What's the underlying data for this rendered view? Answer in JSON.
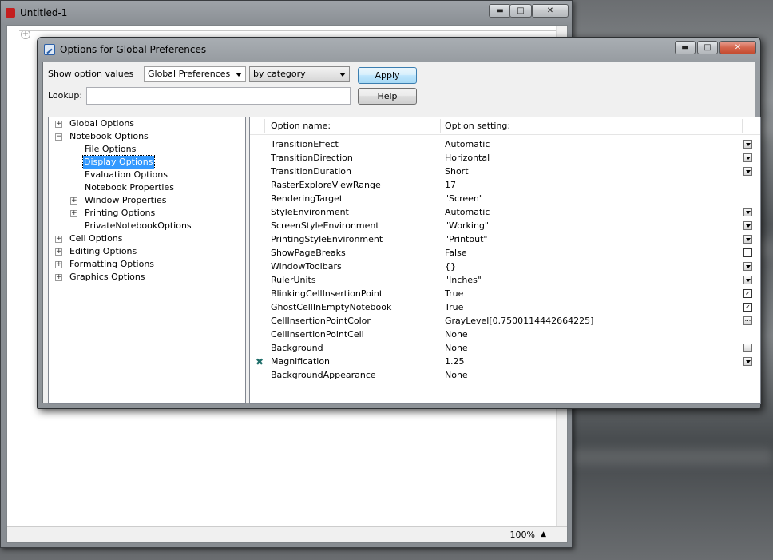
{
  "notebook": {
    "title": "Untitled-1",
    "zoom": "100%",
    "controls": [
      "▬",
      "□",
      "✕"
    ]
  },
  "dialog": {
    "title": "Options for Global Preferences",
    "controls": [
      "▬",
      "□",
      "✕"
    ],
    "show_label": "Show option values",
    "scope_value": "Global Preferences",
    "view_value": "by category",
    "apply_label": "Apply",
    "lookup_label": "Lookup:",
    "lookup_value": "",
    "help_label": "Help",
    "tree": [
      {
        "label": "Global Options",
        "expander": "+"
      },
      {
        "label": "Notebook Options",
        "expander": "−"
      },
      {
        "label": "File Options",
        "expander": ""
      },
      {
        "label": "Display Options",
        "expander": "",
        "selected": true
      },
      {
        "label": "Evaluation Options",
        "expander": ""
      },
      {
        "label": "Notebook Properties",
        "expander": ""
      },
      {
        "label": "Window Properties",
        "expander": "+"
      },
      {
        "label": "Printing Options",
        "expander": "+"
      },
      {
        "label": "PrivateNotebookOptions",
        "expander": ""
      },
      {
        "label": "Cell Options",
        "expander": "+"
      },
      {
        "label": "Editing Options",
        "expander": "+"
      },
      {
        "label": "Formatting Options",
        "expander": "+"
      },
      {
        "label": "Graphics Options",
        "expander": "+"
      }
    ],
    "grid": {
      "col_name": "Option name:",
      "col_setting": "Option setting:",
      "rows": [
        {
          "name": "TransitionEffect",
          "value": "Automatic",
          "control": "dropdown"
        },
        {
          "name": "TransitionDirection",
          "value": "Horizontal",
          "control": "dropdown"
        },
        {
          "name": "TransitionDuration",
          "value": "Short",
          "control": "dropdown"
        },
        {
          "name": "RasterExploreViewRange",
          "value": "17",
          "control": ""
        },
        {
          "name": "RenderingTarget",
          "value": "\"Screen\"",
          "control": ""
        },
        {
          "name": "StyleEnvironment",
          "value": "Automatic",
          "control": "dropdown"
        },
        {
          "name": "ScreenStyleEnvironment",
          "value": "\"Working\"",
          "control": "dropdown"
        },
        {
          "name": "PrintingStyleEnvironment",
          "value": "\"Printout\"",
          "control": "dropdown"
        },
        {
          "name": "ShowPageBreaks",
          "value": "False",
          "control": "checkbox-off"
        },
        {
          "name": "WindowToolbars",
          "value": "{}",
          "control": "dropdown"
        },
        {
          "name": "RulerUnits",
          "value": "\"Inches\"",
          "control": "dropdown"
        },
        {
          "name": "BlinkingCellInsertionPoint",
          "value": "True",
          "control": "checkbox-on"
        },
        {
          "name": "GhostCellInEmptyNotebook",
          "value": "True",
          "control": "checkbox-on"
        },
        {
          "name": "CellInsertionPointColor",
          "value": "GrayLevel[0.7500114442664225]",
          "control": "dots"
        },
        {
          "name": "CellInsertionPointCell",
          "value": "None",
          "control": ""
        },
        {
          "name": "Background",
          "value": "None",
          "control": "dots"
        },
        {
          "name": "Magnification",
          "value": "1.25",
          "control": "dropdown",
          "modified": true
        },
        {
          "name": "BackgroundAppearance",
          "value": "None",
          "control": ""
        }
      ]
    }
  }
}
